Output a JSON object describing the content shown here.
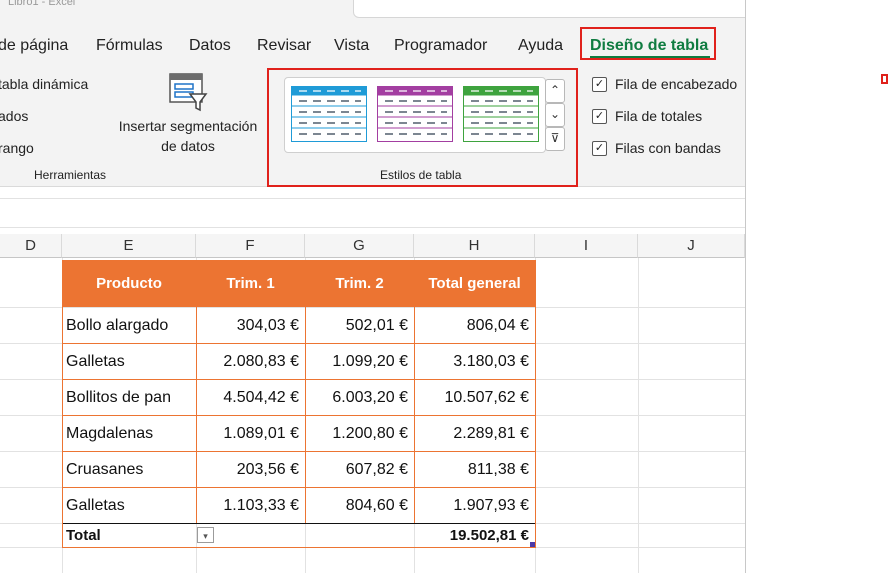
{
  "titlebar": {
    "text": "Libro1 - Excel"
  },
  "menu": {
    "items": [
      "de página",
      "Fórmulas",
      "Datos",
      "Revisar",
      "Vista",
      "Programador",
      "Ayuda"
    ],
    "active": "Diseño de tabla"
  },
  "ribbon": {
    "tools": {
      "items": [
        "tabla dinámica",
        "ados",
        "rango"
      ],
      "slicer_label_1": "Insertar segmentación",
      "slicer_label_2": "de datos",
      "group_label": "Herramientas"
    },
    "styles": {
      "group_label": "Estilos de tabla",
      "thumb_colors": [
        "#1f9bd7",
        "#a33ea1",
        "#3ea33e"
      ],
      "scroll_up": "⌃",
      "scroll_down": "⌄",
      "more": "⊽"
    },
    "options": {
      "header_row": "Fila de encabezado",
      "total_row": "Fila de totales",
      "banded_rows": "Filas con bandas",
      "header_row_checked": true,
      "total_row_checked": true,
      "banded_rows_checked": true
    }
  },
  "columns": [
    "D",
    "E",
    "F",
    "G",
    "H",
    "I",
    "J"
  ],
  "table": {
    "headers": [
      "Producto",
      "Trim. 1",
      "Trim. 2",
      "Total general"
    ],
    "rows": [
      [
        "Bollo alargado",
        "304,03 €",
        "502,01 €",
        "806,04 €"
      ],
      [
        "Galletas",
        "2.080,83 €",
        "1.099,20 €",
        "3.180,03 €"
      ],
      [
        "Bollitos de pan",
        "4.504,42 €",
        "6.003,20 €",
        "10.507,62 €"
      ],
      [
        "Magdalenas",
        "1.089,01 €",
        "1.200,80 €",
        "2.289,81 €"
      ],
      [
        "Cruasanes",
        "203,56 €",
        "607,82 €",
        "811,38 €"
      ],
      [
        "Galletas",
        "1.103,33 €",
        "804,60 €",
        "1.907,93 €"
      ]
    ],
    "total_label": "Total",
    "total_value": "19.502,81 €",
    "header_color": "#ec7432",
    "dropdown_icon": "▾"
  }
}
